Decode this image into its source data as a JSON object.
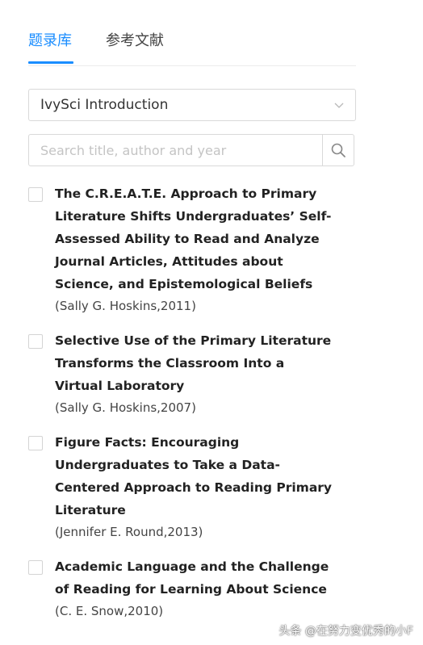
{
  "tabs": [
    {
      "label": "题录库",
      "active": true
    },
    {
      "label": "参考文献",
      "active": false
    }
  ],
  "collection_select": {
    "value": "IvySci Introduction",
    "icon": "chevron-down-icon"
  },
  "search": {
    "placeholder": "Search title, author and year",
    "value": "",
    "icon": "search-icon"
  },
  "references": [
    {
      "title": "The C.R.E.A.T.E. Approach to Primary Literature Shifts Undergraduates’ Self-Assessed Ability to Read and Analyze Journal Articles, Attitudes about Science, and Epistemological Beliefs",
      "meta": "(Sally G. Hoskins,2011)",
      "checked": false
    },
    {
      "title": "Selective Use of the Primary Literature Transforms the Classroom Into a Virtual Laboratory",
      "meta": "(Sally G. Hoskins,2007)",
      "checked": false
    },
    {
      "title": "Figure Facts: Encouraging Undergraduates to Take a Data-Centered Approach to Reading Primary Literature",
      "meta": "(Jennifer E. Round,2013)",
      "checked": false
    },
    {
      "title": "Academic Language and the Challenge of Reading for Learning About Science",
      "meta": "(C. E. Snow,2010)",
      "checked": false
    }
  ],
  "watermark": "头条 @在努力变优秀的小F",
  "colors": {
    "accent": "#1a8dff",
    "border": "#d9d9d9",
    "text": "#222222"
  }
}
